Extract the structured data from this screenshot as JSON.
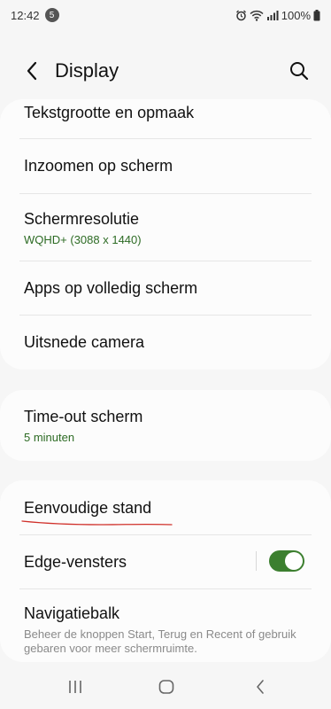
{
  "status_bar": {
    "time": "12:42",
    "notification_count": "5",
    "battery": "100%"
  },
  "header": {
    "title": "Display"
  },
  "settings": {
    "group1": [
      {
        "title": "Tekstgrootte en opmaak"
      },
      {
        "title": "Inzoomen op scherm"
      },
      {
        "title": "Schermresolutie",
        "subtitle": "WQHD+ (3088 x 1440)"
      },
      {
        "title": "Apps op volledig scherm"
      },
      {
        "title": "Uitsnede camera"
      }
    ],
    "group2": [
      {
        "title": "Time-out scherm",
        "subtitle": "5 minuten"
      }
    ],
    "group3": [
      {
        "title": "Eenvoudige stand"
      },
      {
        "title": "Edge-vensters",
        "toggle_on": true
      },
      {
        "title": "Navigatiebalk",
        "description": "Beheer de knoppen Start, Terug en Recent of gebruik gebaren voor meer schermruimte."
      }
    ]
  },
  "colors": {
    "accent_green": "#3c7f2f",
    "subtitle_green": "#2d6b24",
    "annotation_red": "#d0302a"
  }
}
